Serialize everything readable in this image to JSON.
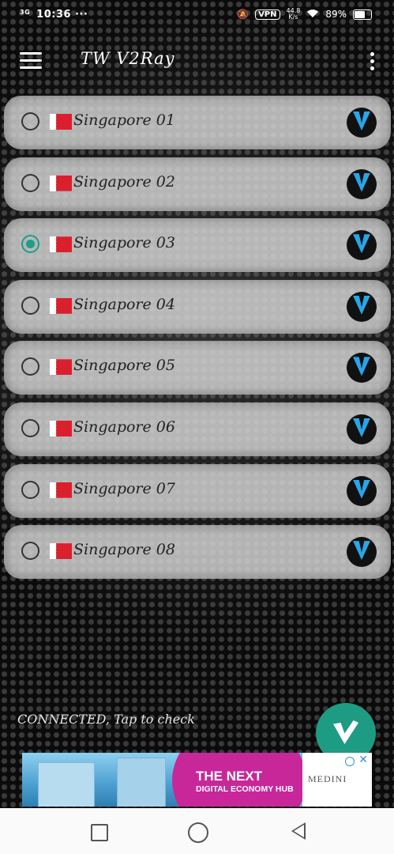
{
  "status_bar": {
    "network": "3G",
    "time": "10:36",
    "vpn": "VPN",
    "speed_top": "44.8",
    "speed_bottom": "K/s",
    "battery": "89%"
  },
  "app_bar": {
    "title": "TW V2Ray"
  },
  "servers": [
    {
      "name": "Singapore 01",
      "selected": false
    },
    {
      "name": "Singapore 02",
      "selected": false
    },
    {
      "name": "Singapore 03",
      "selected": true
    },
    {
      "name": "Singapore 04",
      "selected": false
    },
    {
      "name": "Singapore 05",
      "selected": false
    },
    {
      "name": "Singapore 06",
      "selected": false
    },
    {
      "name": "Singapore 07",
      "selected": false
    },
    {
      "name": "Singapore 08",
      "selected": false
    }
  ],
  "connection_status": "CONNECTED, Tap to check",
  "ad": {
    "headline": "THE NEXT",
    "subline": "DIGITAL ECONOMY HUB",
    "brand": "MEDINI"
  },
  "colors": {
    "accent": "#1f9e87",
    "row_bg": "#d7d7d7",
    "logo_blue": "#2aa5e8"
  },
  "icons": {
    "menu": "hamburger-icon",
    "more": "more-vert-icon",
    "server_logo": "v-logo-icon",
    "fab": "v-logo-icon"
  }
}
